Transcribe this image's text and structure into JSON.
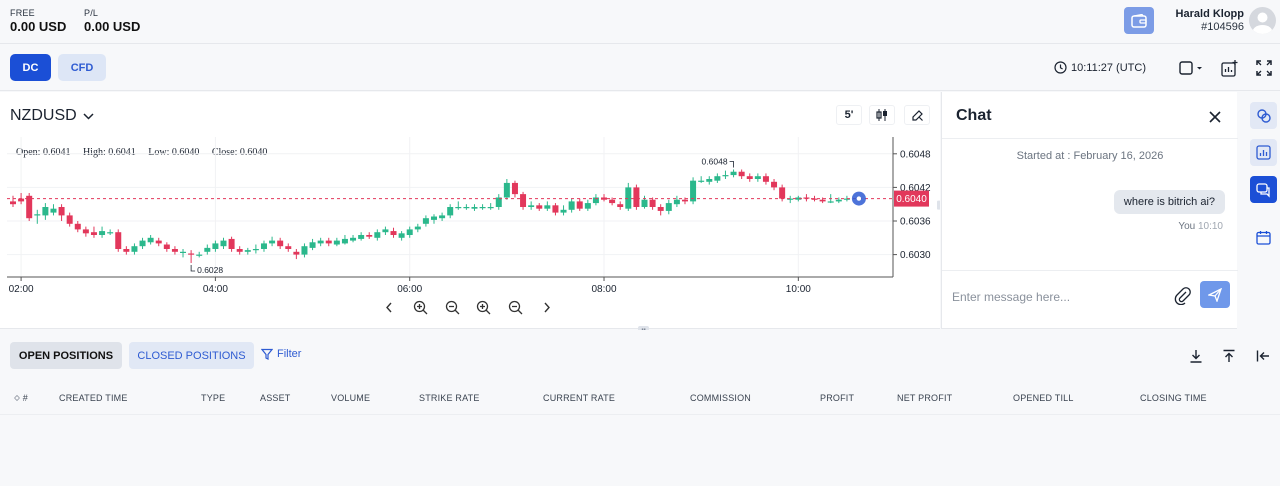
{
  "header": {
    "free": {
      "label": "FREE",
      "value": "0.00 USD"
    },
    "pl": {
      "label": "P/L",
      "value": "0.00 USD"
    },
    "user": {
      "name": "Harald Klopp",
      "id": "#104596"
    }
  },
  "toolbar": {
    "mode_dc": "DC",
    "mode_cfd": "CFD",
    "time": "10:11:27 (UTC)"
  },
  "chart": {
    "symbol": "NZDUSD",
    "timeframe": "5'",
    "ohlc": {
      "open": "Open: 0.6041",
      "high": "High: 0.6041",
      "low": "Low: 0.6040",
      "close": "Close: 0.6040"
    },
    "high_marker": "0.6048",
    "low_marker": "0.6028",
    "current_price": "0.6040"
  },
  "chart_data": {
    "type": "candlestick",
    "x_ticks": [
      "02:00",
      "04:00",
      "06:00",
      "08:00",
      "10:00"
    ],
    "y_ticks": [
      "0.6048",
      "0.6042",
      "0.6036",
      "0.6030"
    ],
    "ylim": [
      0.6026,
      0.6051
    ],
    "current_price": 0.604,
    "up_color": "#2bb88c",
    "down_color": "#e2375b",
    "candles": [
      {
        "o": 0.60395,
        "c": 0.6039,
        "h": 0.60405,
        "l": 0.60385
      },
      {
        "o": 0.604,
        "c": 0.60395,
        "h": 0.6041,
        "l": 0.6039
      },
      {
        "o": 0.60405,
        "c": 0.60365,
        "h": 0.6041,
        "l": 0.6036
      },
      {
        "o": 0.6037,
        "c": 0.60372,
        "h": 0.6038,
        "l": 0.60355
      },
      {
        "o": 0.6037,
        "c": 0.60385,
        "h": 0.60392,
        "l": 0.60362
      },
      {
        "o": 0.60375,
        "c": 0.60382,
        "h": 0.6039,
        "l": 0.6037
      },
      {
        "o": 0.60385,
        "c": 0.6037,
        "h": 0.6039,
        "l": 0.6036
      },
      {
        "o": 0.6037,
        "c": 0.60355,
        "h": 0.60375,
        "l": 0.6035
      },
      {
        "o": 0.60355,
        "c": 0.60345,
        "h": 0.6036,
        "l": 0.6034
      },
      {
        "o": 0.60345,
        "c": 0.60338,
        "h": 0.6035,
        "l": 0.60332
      },
      {
        "o": 0.6034,
        "c": 0.60335,
        "h": 0.6035,
        "l": 0.6033
      },
      {
        "o": 0.60335,
        "c": 0.60342,
        "h": 0.6035,
        "l": 0.6033
      },
      {
        "o": 0.6034,
        "c": 0.6034,
        "h": 0.60345,
        "l": 0.60335
      },
      {
        "o": 0.6034,
        "c": 0.6031,
        "h": 0.60345,
        "l": 0.60305
      },
      {
        "o": 0.6031,
        "c": 0.60305,
        "h": 0.60315,
        "l": 0.603
      },
      {
        "o": 0.60305,
        "c": 0.60315,
        "h": 0.6032,
        "l": 0.603
      },
      {
        "o": 0.60315,
        "c": 0.60325,
        "h": 0.6033,
        "l": 0.6031
      },
      {
        "o": 0.60322,
        "c": 0.6033,
        "h": 0.60335,
        "l": 0.60318
      },
      {
        "o": 0.60325,
        "c": 0.6032,
        "h": 0.6033,
        "l": 0.60315
      },
      {
        "o": 0.60318,
        "c": 0.6031,
        "h": 0.60322,
        "l": 0.60305
      },
      {
        "o": 0.6031,
        "c": 0.60305,
        "h": 0.60315,
        "l": 0.603
      },
      {
        "o": 0.60305,
        "c": 0.60305,
        "h": 0.6031,
        "l": 0.60295
      },
      {
        "o": 0.60302,
        "c": 0.603,
        "h": 0.60308,
        "l": 0.60285
      },
      {
        "o": 0.603,
        "c": 0.603,
        "h": 0.60305,
        "l": 0.60295
      },
      {
        "o": 0.60305,
        "c": 0.60312,
        "h": 0.60318,
        "l": 0.603
      },
      {
        "o": 0.6031,
        "c": 0.6032,
        "h": 0.60325,
        "l": 0.60305
      },
      {
        "o": 0.60315,
        "c": 0.60325,
        "h": 0.6033,
        "l": 0.6031
      },
      {
        "o": 0.60328,
        "c": 0.6031,
        "h": 0.60332,
        "l": 0.60305
      },
      {
        "o": 0.6031,
        "c": 0.60305,
        "h": 0.60315,
        "l": 0.603
      },
      {
        "o": 0.60305,
        "c": 0.60308,
        "h": 0.60312,
        "l": 0.603
      },
      {
        "o": 0.60308,
        "c": 0.6031,
        "h": 0.60318,
        "l": 0.60302
      },
      {
        "o": 0.6031,
        "c": 0.6032,
        "h": 0.60325,
        "l": 0.60305
      },
      {
        "o": 0.6032,
        "c": 0.60325,
        "h": 0.60332,
        "l": 0.60315
      },
      {
        "o": 0.60325,
        "c": 0.60315,
        "h": 0.6033,
        "l": 0.6031
      },
      {
        "o": 0.60315,
        "c": 0.6031,
        "h": 0.6032,
        "l": 0.60305
      },
      {
        "o": 0.60305,
        "c": 0.603,
        "h": 0.6031,
        "l": 0.60292
      },
      {
        "o": 0.603,
        "c": 0.60315,
        "h": 0.6032,
        "l": 0.60295
      },
      {
        "o": 0.60312,
        "c": 0.60322,
        "h": 0.60328,
        "l": 0.60308
      },
      {
        "o": 0.6032,
        "c": 0.60325,
        "h": 0.6033,
        "l": 0.60315
      },
      {
        "o": 0.60325,
        "c": 0.6032,
        "h": 0.6033,
        "l": 0.60315
      },
      {
        "o": 0.60318,
        "c": 0.60325,
        "h": 0.6033,
        "l": 0.60315
      },
      {
        "o": 0.6032,
        "c": 0.60328,
        "h": 0.60335,
        "l": 0.60318
      },
      {
        "o": 0.60325,
        "c": 0.6033,
        "h": 0.60335,
        "l": 0.60322
      },
      {
        "o": 0.60328,
        "c": 0.60335,
        "h": 0.6034,
        "l": 0.60325
      },
      {
        "o": 0.60335,
        "c": 0.60332,
        "h": 0.6034,
        "l": 0.60328
      },
      {
        "o": 0.6033,
        "c": 0.6034,
        "h": 0.60345,
        "l": 0.60325
      },
      {
        "o": 0.6034,
        "c": 0.60345,
        "h": 0.6035,
        "l": 0.60335
      },
      {
        "o": 0.60342,
        "c": 0.60335,
        "h": 0.60348,
        "l": 0.6033
      },
      {
        "o": 0.6033,
        "c": 0.60338,
        "h": 0.60342,
        "l": 0.60325
      },
      {
        "o": 0.60335,
        "c": 0.60345,
        "h": 0.6035,
        "l": 0.6033
      },
      {
        "o": 0.60345,
        "c": 0.6035,
        "h": 0.60355,
        "l": 0.6034
      },
      {
        "o": 0.60355,
        "c": 0.60365,
        "h": 0.6037,
        "l": 0.6035
      },
      {
        "o": 0.60362,
        "c": 0.60368,
        "h": 0.60372,
        "l": 0.60355
      },
      {
        "o": 0.60365,
        "c": 0.6037,
        "h": 0.60375,
        "l": 0.6036
      },
      {
        "o": 0.6037,
        "c": 0.60385,
        "h": 0.6039,
        "l": 0.60365
      },
      {
        "o": 0.60385,
        "c": 0.60385,
        "h": 0.60395,
        "l": 0.6038
      },
      {
        "o": 0.60385,
        "c": 0.60385,
        "h": 0.6039,
        "l": 0.6038
      },
      {
        "o": 0.60382,
        "c": 0.60385,
        "h": 0.6039,
        "l": 0.60378
      },
      {
        "o": 0.60385,
        "c": 0.60385,
        "h": 0.6039,
        "l": 0.6038
      },
      {
        "o": 0.60385,
        "c": 0.60385,
        "h": 0.60392,
        "l": 0.6038
      },
      {
        "o": 0.60385,
        "c": 0.60402,
        "h": 0.60408,
        "l": 0.6038
      },
      {
        "o": 0.60402,
        "c": 0.60428,
        "h": 0.60435,
        "l": 0.60398
      },
      {
        "o": 0.60428,
        "c": 0.60408,
        "h": 0.60432,
        "l": 0.60402
      },
      {
        "o": 0.60408,
        "c": 0.60385,
        "h": 0.60412,
        "l": 0.6038
      },
      {
        "o": 0.60385,
        "c": 0.60388,
        "h": 0.60395,
        "l": 0.6038
      },
      {
        "o": 0.60388,
        "c": 0.60382,
        "h": 0.60392,
        "l": 0.60378
      },
      {
        "o": 0.60382,
        "c": 0.60388,
        "h": 0.60395,
        "l": 0.60378
      },
      {
        "o": 0.60388,
        "c": 0.60375,
        "h": 0.60392,
        "l": 0.6037
      },
      {
        "o": 0.60375,
        "c": 0.6038,
        "h": 0.60388,
        "l": 0.6037
      },
      {
        "o": 0.6038,
        "c": 0.60395,
        "h": 0.604,
        "l": 0.60375
      },
      {
        "o": 0.60395,
        "c": 0.60382,
        "h": 0.604,
        "l": 0.60378
      },
      {
        "o": 0.60382,
        "c": 0.60392,
        "h": 0.60398,
        "l": 0.60378
      },
      {
        "o": 0.60392,
        "c": 0.60402,
        "h": 0.60408,
        "l": 0.60388
      },
      {
        "o": 0.60402,
        "c": 0.60398,
        "h": 0.60408,
        "l": 0.60395
      },
      {
        "o": 0.60398,
        "c": 0.60392,
        "h": 0.60402,
        "l": 0.60388
      },
      {
        "o": 0.6039,
        "c": 0.60385,
        "h": 0.60395,
        "l": 0.6038
      },
      {
        "o": 0.60382,
        "c": 0.6042,
        "h": 0.60428,
        "l": 0.60378
      },
      {
        "o": 0.6042,
        "c": 0.60385,
        "h": 0.60425,
        "l": 0.6038
      },
      {
        "o": 0.60385,
        "c": 0.60398,
        "h": 0.60405,
        "l": 0.60382
      },
      {
        "o": 0.60398,
        "c": 0.60385,
        "h": 0.60402,
        "l": 0.6038
      },
      {
        "o": 0.60385,
        "c": 0.60378,
        "h": 0.6039,
        "l": 0.6037
      },
      {
        "o": 0.60378,
        "c": 0.60392,
        "h": 0.60398,
        "l": 0.60372
      },
      {
        "o": 0.6039,
        "c": 0.60398,
        "h": 0.60405,
        "l": 0.60385
      },
      {
        "o": 0.60398,
        "c": 0.60395,
        "h": 0.60402,
        "l": 0.6039
      },
      {
        "o": 0.60395,
        "c": 0.60432,
        "h": 0.60438,
        "l": 0.6039
      },
      {
        "o": 0.60432,
        "c": 0.60432,
        "h": 0.6044,
        "l": 0.60428
      },
      {
        "o": 0.6043,
        "c": 0.60435,
        "h": 0.6044,
        "l": 0.60425
      },
      {
        "o": 0.60432,
        "c": 0.6044,
        "h": 0.60445,
        "l": 0.60428
      },
      {
        "o": 0.6044,
        "c": 0.60442,
        "h": 0.6045,
        "l": 0.60435
      },
      {
        "o": 0.60442,
        "c": 0.60448,
        "h": 0.60452,
        "l": 0.60438
      },
      {
        "o": 0.60448,
        "c": 0.6044,
        "h": 0.60452,
        "l": 0.60435
      },
      {
        "o": 0.6044,
        "c": 0.60435,
        "h": 0.60445,
        "l": 0.6043
      },
      {
        "o": 0.60435,
        "c": 0.6044,
        "h": 0.60445,
        "l": 0.6043
      },
      {
        "o": 0.6044,
        "c": 0.6043,
        "h": 0.60445,
        "l": 0.60425
      },
      {
        "o": 0.6043,
        "c": 0.6042,
        "h": 0.60435,
        "l": 0.60415
      },
      {
        "o": 0.6042,
        "c": 0.604,
        "h": 0.60425,
        "l": 0.60395
      },
      {
        "o": 0.604,
        "c": 0.604,
        "h": 0.60405,
        "l": 0.60392
      },
      {
        "o": 0.60398,
        "c": 0.60402,
        "h": 0.60405,
        "l": 0.60395
      },
      {
        "o": 0.60402,
        "c": 0.604,
        "h": 0.60408,
        "l": 0.60395
      },
      {
        "o": 0.604,
        "c": 0.60398,
        "h": 0.60405,
        "l": 0.60395
      },
      {
        "o": 0.60398,
        "c": 0.60395,
        "h": 0.60402,
        "l": 0.60392
      },
      {
        "o": 0.60395,
        "c": 0.60395,
        "h": 0.60408,
        "l": 0.60392
      },
      {
        "o": 0.60395,
        "c": 0.60398,
        "h": 0.60402,
        "l": 0.60392
      },
      {
        "o": 0.60398,
        "c": 0.604,
        "h": 0.60405,
        "l": 0.60395
      }
    ]
  },
  "chat": {
    "title": "Chat",
    "started": "Started at : February 16, 2026",
    "message": "where is bitrich ai?",
    "sender": "You",
    "time": "10:10",
    "placeholder": "Enter message here..."
  },
  "positions": {
    "tab_open": "OPEN POSITIONS",
    "tab_closed": "CLOSED POSITIONS",
    "filter": "Filter",
    "columns": [
      "#",
      "CREATED TIME",
      "TYPE",
      "ASSET",
      "VOLUME",
      "STRIKE RATE",
      "CURRENT RATE",
      "COMMISSION",
      "PROFIT",
      "NET PROFIT",
      "OPENED TILL",
      "CLOSING TIME"
    ]
  }
}
